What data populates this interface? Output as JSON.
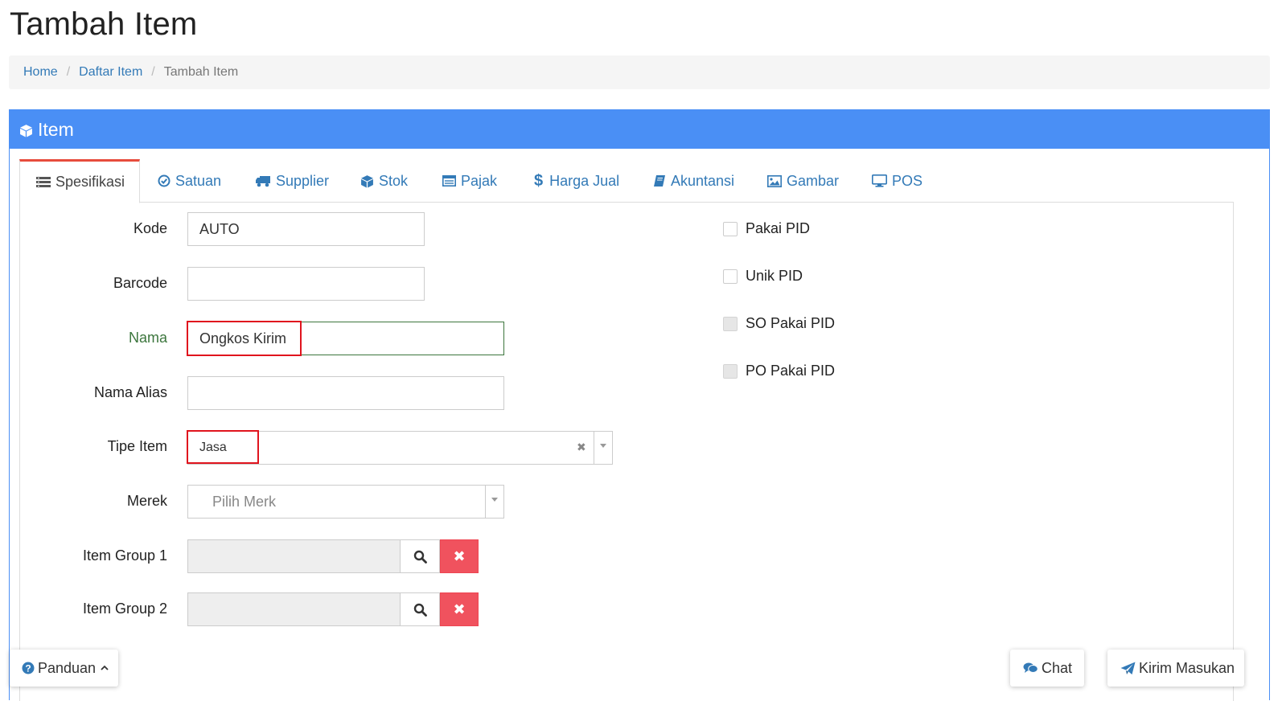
{
  "page_title": "Tambah Item",
  "breadcrumb": {
    "home": "Home",
    "list": "Daftar Item",
    "current": "Tambah Item"
  },
  "panel": {
    "title": "Item"
  },
  "tabs": [
    {
      "label": "Spesifikasi",
      "icon": "list-icon"
    },
    {
      "label": "Satuan",
      "icon": "check-circle-icon"
    },
    {
      "label": "Supplier",
      "icon": "truck-icon"
    },
    {
      "label": "Stok",
      "icon": "cube-icon"
    },
    {
      "label": "Pajak",
      "icon": "table-icon"
    },
    {
      "label": "Harga Jual",
      "icon": "dollar-icon"
    },
    {
      "label": "Akuntansi",
      "icon": "book-icon"
    },
    {
      "label": "Gambar",
      "icon": "image-icon"
    },
    {
      "label": "POS",
      "icon": "monitor-icon"
    }
  ],
  "form": {
    "kode": {
      "label": "Kode",
      "value": "AUTO"
    },
    "barcode": {
      "label": "Barcode",
      "value": ""
    },
    "nama": {
      "label": "Nama",
      "value": "Ongkos Kirim"
    },
    "nama_alias": {
      "label": "Nama Alias",
      "value": ""
    },
    "tipe_item": {
      "label": "Tipe Item",
      "value": "Jasa"
    },
    "merek": {
      "label": "Merek",
      "placeholder": "Pilih Merk"
    },
    "item_group_1": {
      "label": "Item Group 1",
      "value": ""
    },
    "item_group_2": {
      "label": "Item Group 2",
      "value": ""
    }
  },
  "checkboxes": [
    {
      "label": "Pakai PID",
      "disabled": false
    },
    {
      "label": "Unik PID",
      "disabled": false
    },
    {
      "label": "SO Pakai PID",
      "disabled": true
    },
    {
      "label": "PO Pakai PID",
      "disabled": true
    }
  ],
  "footer": {
    "guide": "Panduan",
    "chat": "Chat",
    "feedback": "Kirim Masukan"
  },
  "colors": {
    "primary": "#4a8ff5",
    "link": "#337ab7",
    "danger": "#f0525e",
    "highlight": "#e0141e",
    "success": "#3c763d"
  }
}
